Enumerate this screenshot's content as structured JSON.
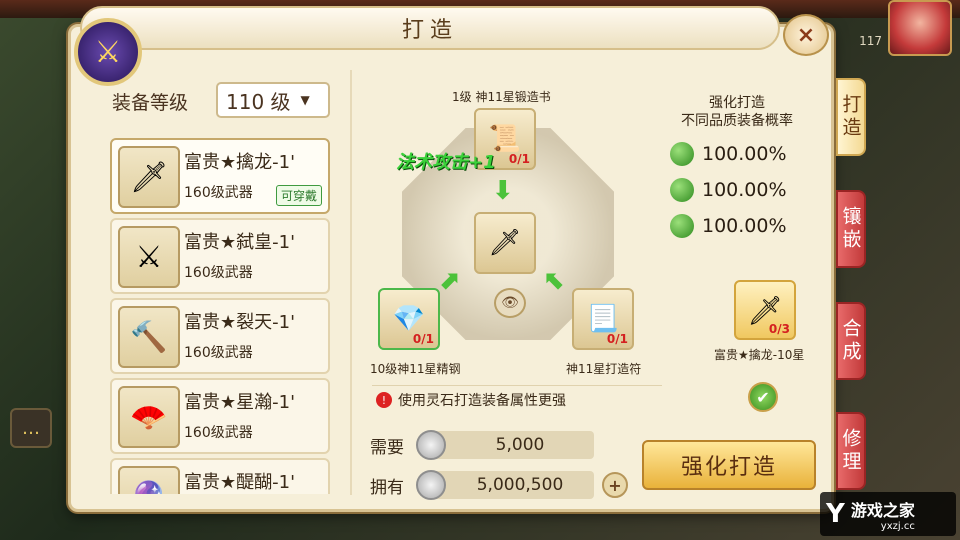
{
  "window": {
    "title": "打造",
    "close_icon": "×",
    "top_level_badge": "117"
  },
  "filter": {
    "label": "装备等级",
    "level_value": "110 级",
    "dropdown_icon": "▼"
  },
  "items": [
    {
      "name": "富贵★擒龙-1'",
      "sub": "160级武器",
      "tag": "可穿戴",
      "icon": "🗡",
      "selected": true
    },
    {
      "name": "富贵★弑皇-1'",
      "sub": "160级武器",
      "icon": "⚔"
    },
    {
      "name": "富贵★裂天-1'",
      "sub": "160级武器",
      "icon": "🔨"
    },
    {
      "name": "富贵★星瀚-1'",
      "sub": "160级武器",
      "icon": "🪭"
    },
    {
      "name": "富贵★醍醐-1'",
      "sub": "",
      "icon": "🔮"
    }
  ],
  "forge": {
    "top_material": {
      "label": "1级  神11星锻造书",
      "count": "0/1",
      "icon": "📜"
    },
    "center_item": {
      "icon": "🗡"
    },
    "left_material": {
      "label": "10级神11星精钢",
      "count": "0/1",
      "icon": "💎"
    },
    "right_material": {
      "label": "神11星打造符",
      "count": "0/1",
      "icon": "📃"
    },
    "float_text": "法术攻击+1",
    "eye_icon": "👁",
    "hint": "使用灵石打造装备属性更强",
    "warn_icon": "!"
  },
  "cost": {
    "need_label": "需要",
    "need_value": "5,000",
    "have_label": "拥有",
    "have_value": "5,000,500",
    "plus_icon": "+"
  },
  "rates": {
    "title_line1": "强化打造",
    "title_line2": "不同品质装备概率",
    "values": [
      "100.00%",
      "100.00%",
      "100.00%"
    ]
  },
  "result": {
    "icon": "🗡",
    "count": "0/3",
    "label": "富贵★擒龙-10星",
    "check_icon": "✔"
  },
  "forge_button": "强化打造",
  "side_tabs": [
    "打造",
    "镶嵌",
    "合成",
    "修理"
  ],
  "watermark": {
    "logo": "Y",
    "title": "游戏之家",
    "url": "yxzj.cc"
  },
  "chat_icon": "…",
  "colors": {
    "panel_bg": "#f6efd9",
    "accent_gold": "#e9b23a",
    "rate_green": "#2e8a1e",
    "tab_red": "#c23a3a"
  }
}
